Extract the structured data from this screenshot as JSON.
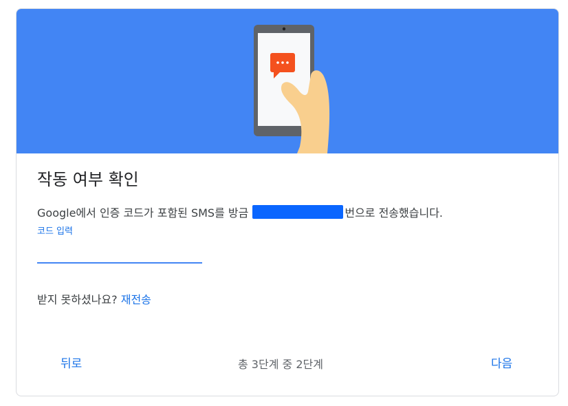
{
  "hero": {
    "illustration": "hand-holding-phone-with-sms-icon",
    "background_color": "#4285f4"
  },
  "title": "작동 여부 확인",
  "description": {
    "prefix": "Google에서 인증 코드가 포함된 SMS를 방금",
    "suffix": "번으로 전송했습니다."
  },
  "code_field": {
    "label": "코드 입력",
    "value": ""
  },
  "resend": {
    "question": "받지 못하셨나요?",
    "link": "재전송"
  },
  "footer": {
    "back_label": "뒤로",
    "step_text": "총 3단계 중 2단계",
    "next_label": "다음"
  },
  "colors": {
    "accent": "#1a73e8",
    "hero": "#4285f4",
    "redaction": "#0a66ff"
  }
}
